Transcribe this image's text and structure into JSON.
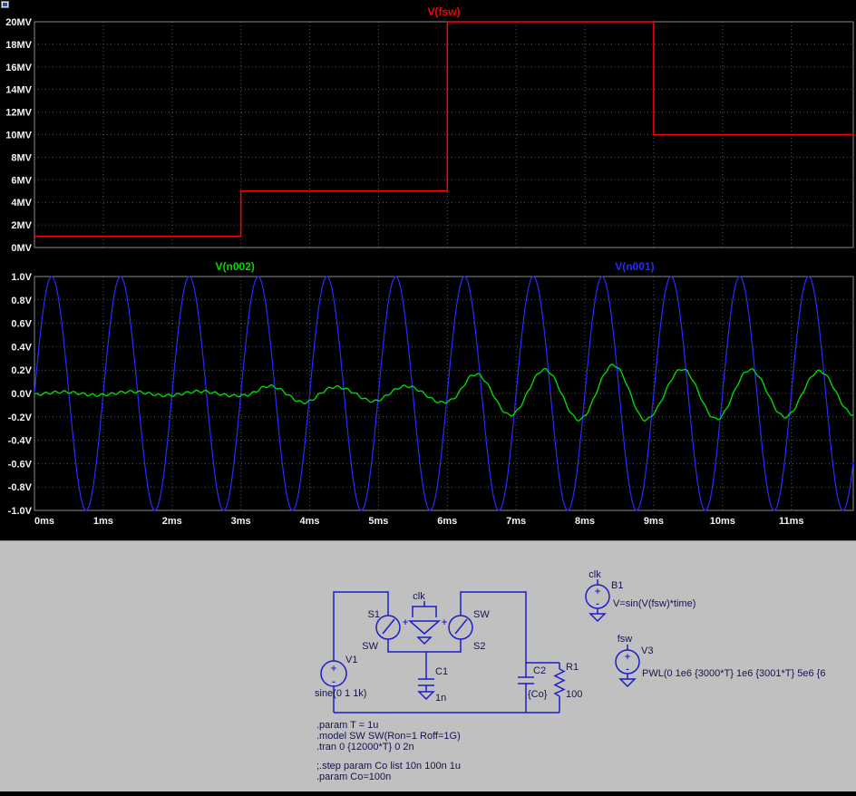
{
  "colors": {
    "plot_background": "#000000",
    "grid": "#585858",
    "frame": "#8a8a8a",
    "axis_text": "#f2f2f2",
    "trace_red": "#ff0000",
    "trace_green": "#00d800",
    "trace_blue": "#2a2aff",
    "schematic_background": "#c0c0c0",
    "wire_blue": "#1c1cc8",
    "schematic_text": "#14144f"
  },
  "chart_data": [
    {
      "type": "line",
      "titles": [
        {
          "label": "V(fsw)",
          "color": "#ff0000",
          "x_frac": 0.5
        }
      ],
      "xlim": [
        0,
        11.9
      ],
      "ylim": [
        0,
        20
      ],
      "ytick_values": [
        0,
        2,
        4,
        6,
        8,
        10,
        12,
        14,
        16,
        18,
        20
      ],
      "ytick_labels": [
        "0MV",
        "2MV",
        "4MV",
        "6MV",
        "8MV",
        "10MV",
        "12MV",
        "14MV",
        "16MV",
        "18MV",
        "20MV"
      ],
      "xtick_values": [
        0,
        1,
        2,
        3,
        4,
        5,
        6,
        7,
        8,
        9,
        10,
        11
      ],
      "xtick_labels": [],
      "grid": true,
      "series": [
        {
          "name": "V(fsw)",
          "color": "#ff0000",
          "width": 1.5,
          "x": [
            0,
            3,
            3,
            6,
            6,
            9,
            9,
            11.9
          ],
          "y": [
            1,
            1,
            5,
            5,
            20,
            20,
            10,
            10
          ]
        }
      ]
    },
    {
      "type": "line",
      "titles": [
        {
          "label": "V(n002)",
          "color": "#00d800",
          "x_frac": 0.245
        },
        {
          "label": "V(n001)",
          "color": "#2a2aff",
          "x_frac": 0.733
        }
      ],
      "xlim": [
        0,
        11.9
      ],
      "ylim": [
        -1,
        1
      ],
      "ytick_values": [
        -1,
        -0.8,
        -0.6,
        -0.4,
        -0.2,
        0,
        0.2,
        0.4,
        0.6,
        0.8,
        1
      ],
      "ytick_labels": [
        "-1.0V",
        "-0.8V",
        "-0.6V",
        "-0.4V",
        "-0.2V",
        "0.0V",
        "0.2V",
        "0.4V",
        "0.6V",
        "0.8V",
        "1.0V"
      ],
      "xtick_values": [
        0,
        1,
        2,
        3,
        4,
        5,
        6,
        7,
        8,
        9,
        10,
        11
      ],
      "xtick_labels": [
        "0ms",
        "1ms",
        "2ms",
        "3ms",
        "4ms",
        "5ms",
        "6ms",
        "7ms",
        "8ms",
        "9ms",
        "10ms",
        "11ms"
      ],
      "grid": true,
      "series": [
        {
          "name": "V(n001)",
          "color": "#2a2aff",
          "width": 1.2,
          "gen": "sine",
          "freq_per_ms": 1,
          "amplitude": 1,
          "phase_rad": 0
        },
        {
          "name": "V(n002)",
          "color": "#00d800",
          "width": 1.4,
          "gen": "mod",
          "freq_per_ms": 1,
          "phase_rad": -1.0,
          "envelope_t_ms": [
            0,
            1,
            2,
            3,
            3.3,
            4,
            4.5,
            5,
            5.5,
            6,
            6.3,
            6.8,
            7.3,
            7.8,
            8.3,
            8.8,
            9,
            9.5,
            10,
            10.5,
            11,
            11.9
          ],
          "envelope_amp": [
            0.012,
            0.015,
            0.018,
            0.02,
            0.06,
            0.08,
            0.05,
            0.07,
            0.06,
            0.08,
            0.16,
            0.18,
            0.2,
            0.22,
            0.24,
            0.25,
            0.2,
            0.21,
            0.22,
            0.2,
            0.2,
            0.18
          ],
          "ripple_amp": 0.01
        }
      ]
    }
  ],
  "schematic": {
    "components": {
      "v1_ref": "V1",
      "v1_value": "sine(0 1 1k)",
      "s1_ref": "S1",
      "s1_model": "SW",
      "s2_ref": "S2",
      "s2_model": "SW",
      "c1_ref": "C1",
      "c1_value": "1n",
      "c2_ref": "C2",
      "c2_value": "{Co}",
      "r1_ref": "R1",
      "r1_value": "100",
      "b1_ref": "B1",
      "b1_value": "V=sin(V(fsw)*time)",
      "v3_ref": "V3",
      "v3_value": "PWL(0 1e6 {3000*T} 1e6 {3001*T} 5e6 {6",
      "net_clk_control": "clk",
      "net_clk_b1": "clk",
      "net_fsw": "fsw"
    },
    "directives": [
      ".param T = 1u",
      ".model SW SW(Ron=1 Roff=1G)",
      ".tran 0 {12000*T} 0 2n",
      ";.step param Co list 10n 100n 1u",
      ".param Co=100n"
    ]
  }
}
